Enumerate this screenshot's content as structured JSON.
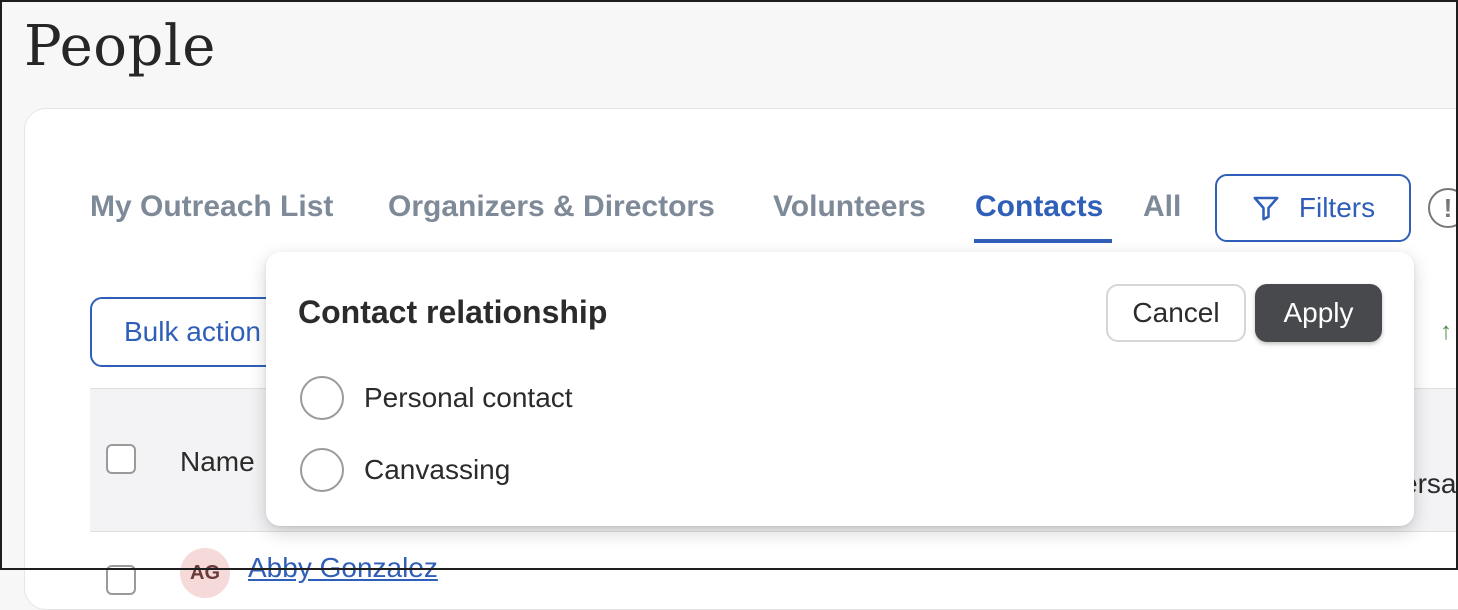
{
  "page": {
    "title": "People"
  },
  "tabs": [
    {
      "label": "My Outreach List",
      "active": false
    },
    {
      "label": "Organizers & Directors",
      "active": false
    },
    {
      "label": "Volunteers",
      "active": false
    },
    {
      "label": "Contacts",
      "active": true
    },
    {
      "label": "All",
      "active": false
    }
  ],
  "toolbar": {
    "filters_label": "Filters",
    "bulk_actions_label": "Bulk action"
  },
  "table": {
    "columns": {
      "name": "Name",
      "conversation": "ersa"
    },
    "rows": [
      {
        "initials": "AG",
        "name": "Abby Gonzalez"
      }
    ]
  },
  "filter_popover": {
    "title": "Contact relationship",
    "cancel_label": "Cancel",
    "apply_label": "Apply",
    "options": [
      {
        "label": "Personal contact",
        "selected": false
      },
      {
        "label": "Canvassing",
        "selected": false
      }
    ]
  },
  "colors": {
    "accent": "#2f5fb8",
    "tab_inactive": "#7f8a99",
    "apply_bg": "#47494d"
  }
}
